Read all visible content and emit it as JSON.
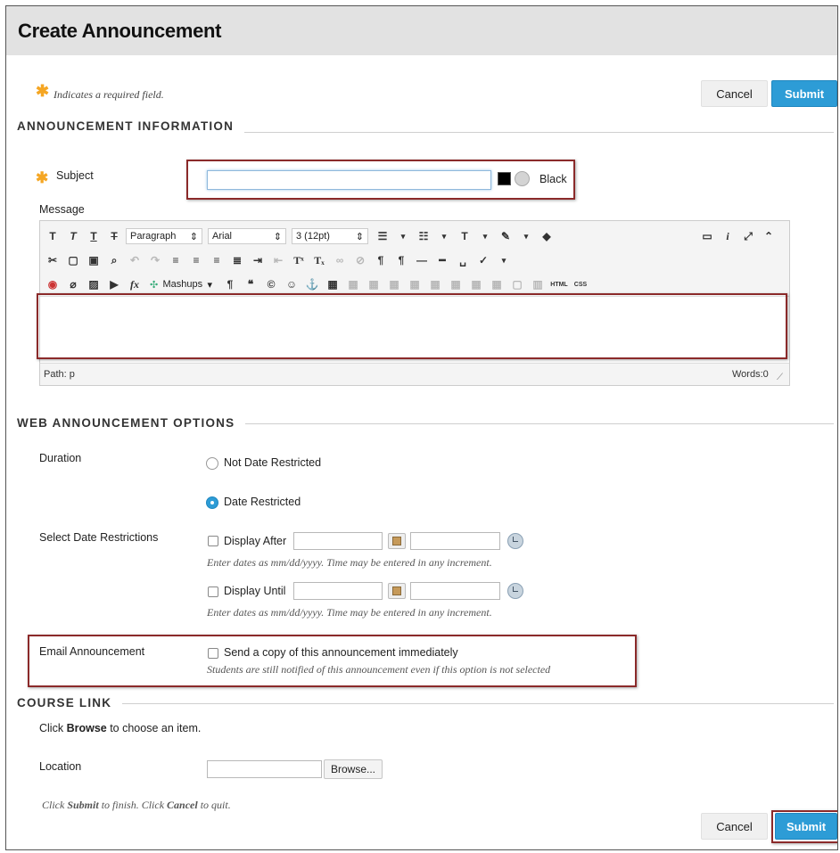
{
  "page": {
    "title": "Create Announcement"
  },
  "required_note": {
    "star": "✱",
    "text": "Indicates a required field."
  },
  "buttons": {
    "cancel": "Cancel",
    "submit": "Submit"
  },
  "sections": {
    "announcement_info": "ANNOUNCEMENT INFORMATION",
    "web_options": "WEB ANNOUNCEMENT OPTIONS",
    "course_link": "COURSE LINK"
  },
  "subject": {
    "label": "Subject",
    "value": "",
    "color_name": "Black",
    "color_hex": "#000000"
  },
  "message": {
    "label": "Message",
    "format_select": "Paragraph",
    "font_select": "Arial",
    "size_select": "3 (12pt)",
    "mashups": "Mashups",
    "html_btn": "HTML",
    "css_btn": "CSS",
    "path": "Path: p",
    "words": "Words:0"
  },
  "duration": {
    "label": "Duration",
    "options": [
      "Not Date Restricted",
      "Date Restricted"
    ],
    "selected": "Date Restricted"
  },
  "date_restrictions": {
    "label": "Select Date Restrictions",
    "display_after": "Display After",
    "display_until": "Display Until",
    "hint": "Enter dates as mm/dd/yyyy. Time may be entered in any increment."
  },
  "email": {
    "label": "Email Announcement",
    "checkbox_label": "Send a copy of this announcement immediately",
    "hint": "Students are still notified of this announcement even if this option is not selected"
  },
  "course_link": {
    "instruction_pre": "Click ",
    "instruction_bold": "Browse",
    "instruction_post": " to choose an item.",
    "location_label": "Location",
    "browse_btn": "Browse..."
  },
  "footer": {
    "p1": "Click ",
    "b1": "Submit",
    "p2": " to finish. Click ",
    "b2": "Cancel",
    "p3": " to quit."
  },
  "colors": {
    "accent": "#2d9cd6",
    "highlight_box": "#8b2a2a",
    "required_star": "#f5a623"
  }
}
